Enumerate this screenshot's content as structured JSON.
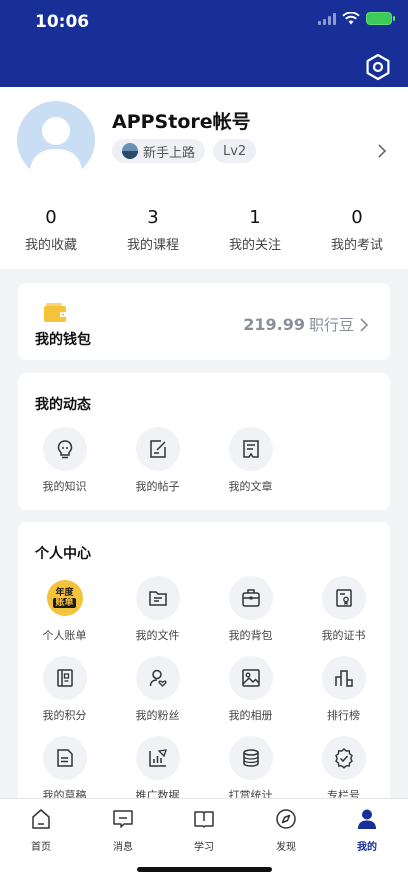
{
  "status_bar": {
    "time": "10:06"
  },
  "profile": {
    "username": "APPStore帐号",
    "rank_tag": "新手上路",
    "level_tag": "Lv2"
  },
  "stats": [
    {
      "value": "0",
      "label": "我的收藏"
    },
    {
      "value": "3",
      "label": "我的课程"
    },
    {
      "value": "1",
      "label": "我的关注"
    },
    {
      "value": "0",
      "label": "我的考试"
    }
  ],
  "wallet": {
    "label": "我的钱包",
    "amount": "219.99",
    "unit": "职行豆"
  },
  "dynamic": {
    "title": "我的动态",
    "items": [
      {
        "label": "我的知识",
        "icon": "lightbulb-icon"
      },
      {
        "label": "我的帖子",
        "icon": "edit-note-icon"
      },
      {
        "label": "我的文章",
        "icon": "article-icon"
      }
    ]
  },
  "center": {
    "title": "个人中心",
    "badge_line1": "年度",
    "badge_line2": "账单",
    "items": [
      {
        "label": "个人账单",
        "icon": "yearly-bill-icon"
      },
      {
        "label": "我的文件",
        "icon": "folder-icon"
      },
      {
        "label": "我的背包",
        "icon": "backpack-icon"
      },
      {
        "label": "我的证书",
        "icon": "certificate-icon"
      },
      {
        "label": "我的积分",
        "icon": "points-icon"
      },
      {
        "label": "我的粉丝",
        "icon": "fans-icon"
      },
      {
        "label": "我的相册",
        "icon": "album-icon"
      },
      {
        "label": "排行榜",
        "icon": "ranking-icon"
      },
      {
        "label": "我的草稿",
        "icon": "draft-icon"
      },
      {
        "label": "推广数据",
        "icon": "promo-data-icon"
      },
      {
        "label": "打赏统计",
        "icon": "reward-stats-icon"
      },
      {
        "label": "专栏号",
        "icon": "column-badge-icon"
      }
    ]
  },
  "tabbar": [
    {
      "label": "首页",
      "icon": "home-icon"
    },
    {
      "label": "消息",
      "icon": "message-icon"
    },
    {
      "label": "学习",
      "icon": "study-icon"
    },
    {
      "label": "发现",
      "icon": "compass-icon"
    },
    {
      "label": "我的",
      "icon": "profile-icon"
    }
  ],
  "colors": {
    "brand": "#172f97",
    "wallet_yellow": "#f5c23b"
  }
}
